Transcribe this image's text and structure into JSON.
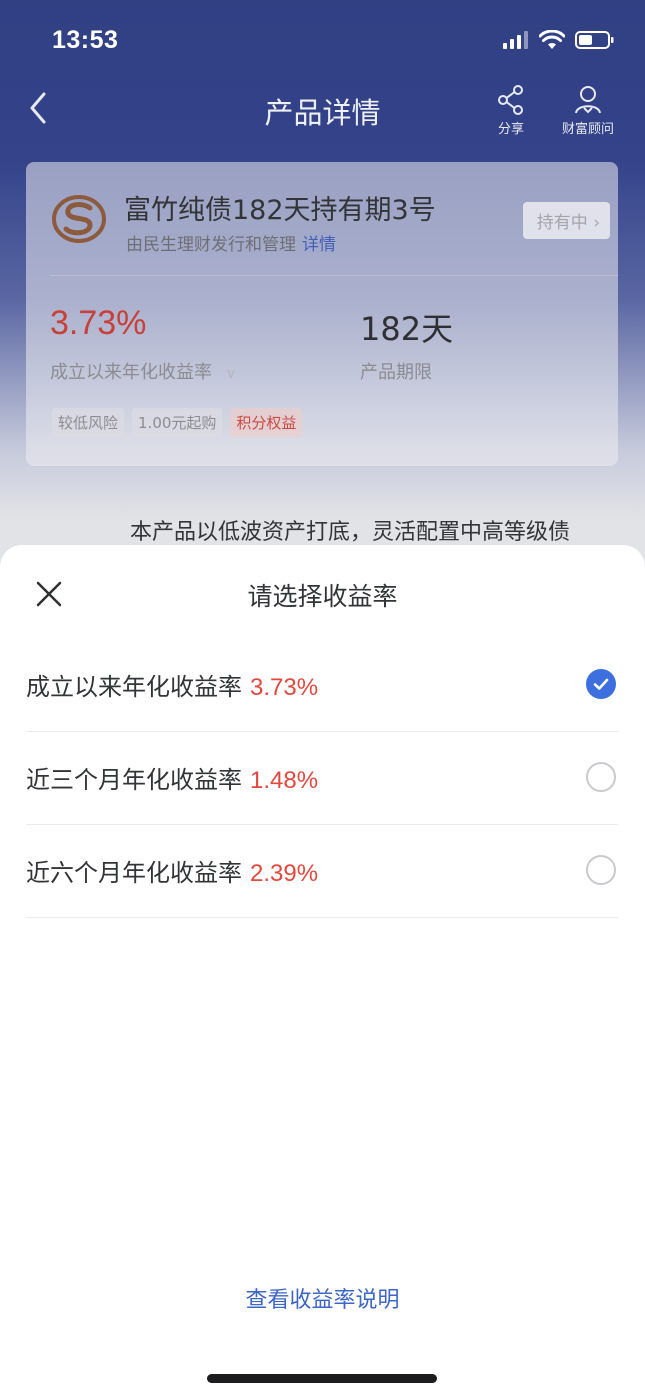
{
  "status_bar": {
    "time": "13:53"
  },
  "nav": {
    "title": "产品详情",
    "share_label": "分享",
    "advisor_label": "财富顾问"
  },
  "product": {
    "name": "富竹纯债182天持有期3号",
    "issuer": "由民生理财发行和管理",
    "detail_link": "详情",
    "status_badge": "持有中",
    "rate": "3.73%",
    "rate_label": "成立以来年化收益率",
    "term": "182天",
    "term_label": "产品期限",
    "tags": [
      "较低风险",
      "1.00元起购",
      "积分权益"
    ]
  },
  "description": "本产品以低波资产打底，灵活配置中高等级债",
  "sheet": {
    "title": "请选择收益率",
    "options": [
      {
        "label": "成立以来年化收益率",
        "value": "3.73%",
        "selected": true
      },
      {
        "label": "近三个月年化收益率",
        "value": "1.48%",
        "selected": false
      },
      {
        "label": "近六个月年化收益率",
        "value": "2.39%",
        "selected": false
      }
    ],
    "explain_link": "查看收益率说明"
  },
  "colors": {
    "nav_bg": "#313f83",
    "rate_red": "#e5473d",
    "accent_blue": "#3d6fdf",
    "link_blue": "#3d66c9"
  },
  "icons": {
    "back": "chevron-left-icon",
    "share": "share-icon",
    "advisor": "person-icon",
    "close": "close-icon",
    "selected": "check-circle-icon",
    "unselected": "radio-empty-icon"
  }
}
